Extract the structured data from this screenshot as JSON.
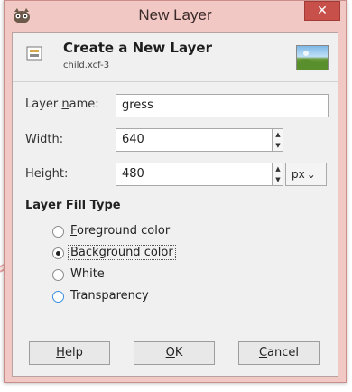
{
  "window": {
    "title": "New Layer",
    "close_symbol": "✕",
    "colors": {
      "titlebar": "#f1c8c4",
      "close": "#c7504a"
    }
  },
  "header": {
    "title": "Create a New Layer",
    "subtitle": "child.xcf-3",
    "icons": {
      "app": "gimp-icon",
      "doc": "layer-icon",
      "thumb": "image-thumbnail"
    }
  },
  "fields": {
    "layer_name": {
      "label_prefix": "Layer ",
      "label_accel": "n",
      "label_suffix": "ame:",
      "value": "gress"
    },
    "width": {
      "label": "Width:",
      "value": "640"
    },
    "height": {
      "label": "Height:",
      "value": "480"
    },
    "unit": {
      "value": "px",
      "chevron": "⌄"
    }
  },
  "fill": {
    "title": "Layer Fill Type",
    "options": [
      {
        "accel": "F",
        "rest": "oreground color",
        "checked": false
      },
      {
        "accel": "B",
        "rest": "ackground color",
        "checked": true
      },
      {
        "accel": "",
        "rest": "White",
        "checked": false
      },
      {
        "accel": "",
        "rest": "Transparency",
        "checked": false
      }
    ]
  },
  "buttons": {
    "help": {
      "accel": "H",
      "rest": "elp"
    },
    "ok": {
      "accel": "O",
      "rest": "K"
    },
    "cancel": {
      "accel": "C",
      "rest": "ancel"
    }
  }
}
